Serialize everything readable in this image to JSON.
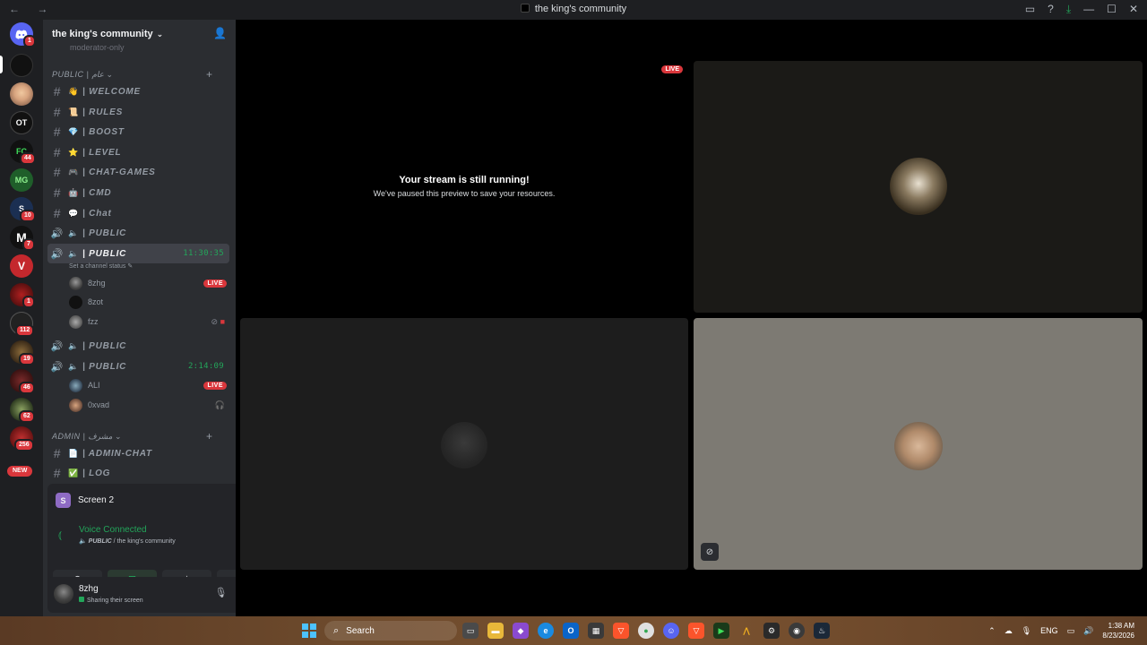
{
  "window": {
    "title": "the king's community",
    "nav_glyphs": "← →"
  },
  "servers": [
    {
      "badge": "1",
      "label": "",
      "color": "#5865f2"
    },
    {
      "badge": "",
      "label": "",
      "color": "#111111"
    },
    {
      "badge": "",
      "label": "",
      "color": "#d8a47f"
    },
    {
      "badge": "",
      "label": "OT",
      "color": "#111111"
    },
    {
      "badge": "44",
      "label": "FC",
      "color": "#111111"
    },
    {
      "badge": "",
      "label": "MG",
      "color": "#1f5e2a"
    },
    {
      "badge": "10",
      "label": "S",
      "color": "#1b2f52"
    },
    {
      "badge": "7",
      "label": "M",
      "color": "#111111"
    },
    {
      "badge": "",
      "label": "V",
      "color": "#c4282d"
    },
    {
      "badge": "1",
      "label": "",
      "color": "#5a1010"
    },
    {
      "badge": "112",
      "label": "",
      "color": "#222222"
    },
    {
      "badge": "19",
      "label": "",
      "color": "#3a2a18"
    },
    {
      "badge": "46",
      "label": "",
      "color": "#3a1212"
    },
    {
      "badge": "62",
      "label": "",
      "color": "#2d3a20"
    },
    {
      "badge": "256",
      "label": "",
      "color": "#6a1414"
    },
    {
      "badge": "NEW",
      "label": "",
      "color": "#333333"
    }
  ],
  "guild": {
    "name": "the king's community",
    "chevron": "⌄",
    "scrolled_item": "moderator-only"
  },
  "categories": {
    "public": "PUBLIC | عام",
    "admin": "ADMIN | مشرف"
  },
  "channels": {
    "welcome": {
      "emoji": "👋",
      "name": "| WELCOME"
    },
    "rules": {
      "emoji": "📜",
      "name": "| RULES"
    },
    "boost": {
      "emoji": "💎",
      "name": "| BOOST"
    },
    "level": {
      "emoji": "⭐",
      "name": "| LEVEL"
    },
    "chat_games": {
      "emoji": "🎮",
      "name": "| CHAT-GAMES"
    },
    "cmd": {
      "emoji": "🤖",
      "name": "| CMD"
    },
    "chat": {
      "emoji": "💬",
      "name": "| Chat"
    },
    "voice1": {
      "name": "| PUBLIC"
    },
    "voice2": {
      "name": "| PUBLIC",
      "time": "11:30:35",
      "status": "Set a channel status ✎"
    },
    "voice3": {
      "name": "| PUBLIC"
    },
    "voice4": {
      "name": "| PUBLIC",
      "time": "2:14:09"
    },
    "admin_chat": {
      "emoji": "📄",
      "name": "| ADMIN-CHAT"
    },
    "log": {
      "emoji": "✅",
      "name": "| LOG"
    }
  },
  "voice_users": {
    "u1": {
      "name": "8zhg",
      "live": "LIVE"
    },
    "u2": {
      "name": "8zot"
    },
    "u3": {
      "name": "fzz"
    },
    "u4": {
      "name": "ALI",
      "live": "LIVE"
    },
    "u5": {
      "name": "0xvad"
    }
  },
  "panel": {
    "screen_name": "Screen 2",
    "screen_letter": "S",
    "voice_status": "Voice Connected",
    "voice_channel": "PUBLIC",
    "voice_sub_rest": " / the king's community"
  },
  "userbar": {
    "name": "8zhg",
    "status": "Sharing their screen"
  },
  "stage": {
    "stream_title": "Your stream is still running!",
    "stream_sub": "We've paused this preview to save your resources.",
    "live": "LIVE"
  },
  "taskbar": {
    "search": "Search",
    "lang": "ENG",
    "time": "1:38 AM",
    "date": "8/23/2026"
  }
}
